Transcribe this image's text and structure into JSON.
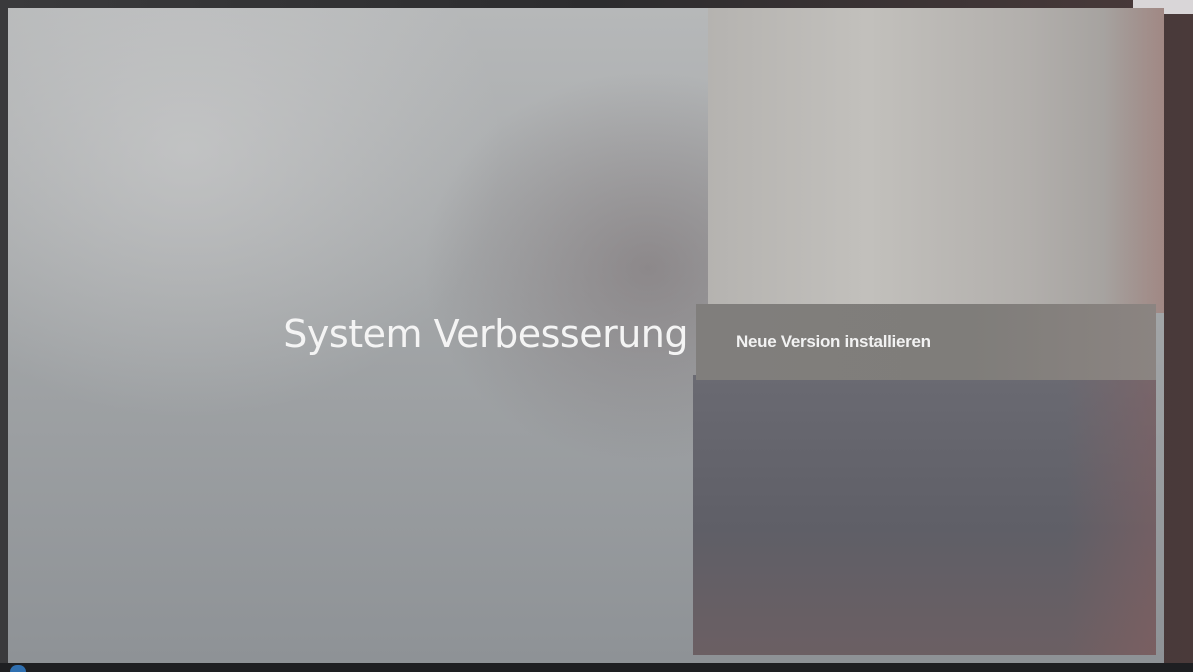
{
  "screen": {
    "title": "System Verbesserung",
    "menu": {
      "items": [
        {
          "label": "Neue Version installieren",
          "selected": true
        }
      ]
    }
  },
  "colors": {
    "background": "#a3a6a8",
    "selected_row": "#807e7c",
    "details_panel": "#63636b",
    "text": "#f4f4f4"
  }
}
